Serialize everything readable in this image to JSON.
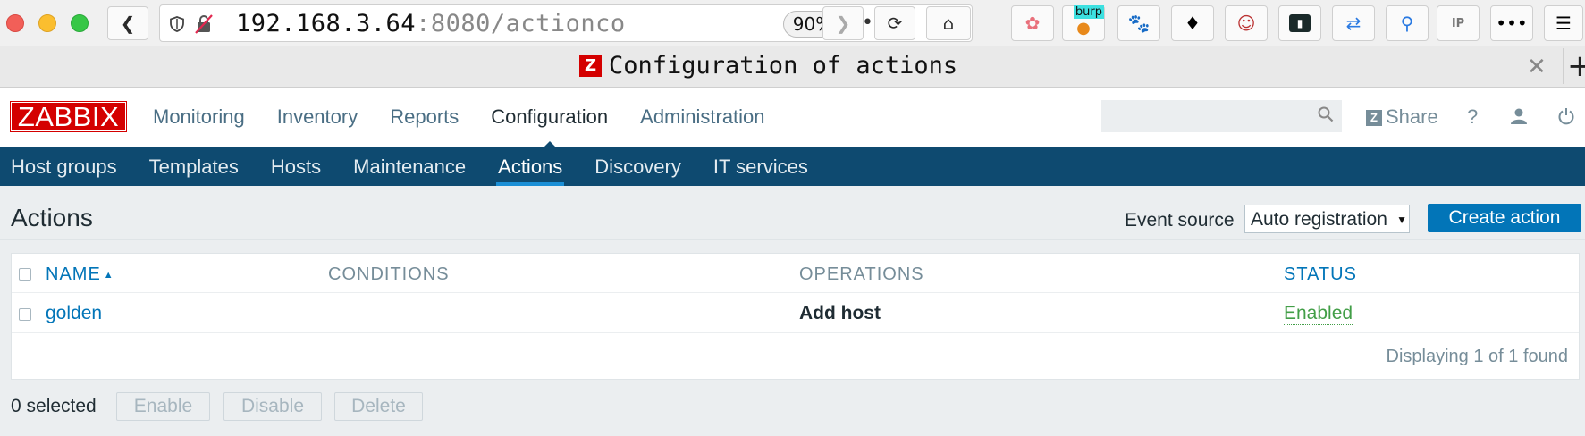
{
  "browser": {
    "url_host": "192.168.3.64",
    "url_rest": ":8080/actionco",
    "zoom": "90%",
    "tab_title": "Configuration of actions",
    "tab_favicon": "Z",
    "extensions": [
      "extension-icon-1",
      "burp-extension-icon",
      "gnome-extension-icon",
      "puzzle-extension-icon",
      "anime-extension-icon",
      "terminal-extension-icon",
      "repeat-extension-icon",
      "key-extension-icon",
      "ip-extension-icon",
      "more-extensions-icon",
      "menu-icon"
    ],
    "burp_badge": "burp"
  },
  "zabbix": {
    "logo": "ZABBIX",
    "topnav": [
      "Monitoring",
      "Inventory",
      "Reports",
      "Configuration",
      "Administration"
    ],
    "active_topnav": "Configuration",
    "share_label": "Share",
    "share_badge": "Z",
    "help_label": "?",
    "subnav": [
      "Host groups",
      "Templates",
      "Hosts",
      "Maintenance",
      "Actions",
      "Discovery",
      "IT services"
    ],
    "active_subnav": "Actions"
  },
  "page": {
    "title": "Actions",
    "event_source_label": "Event source",
    "event_source_value": "Auto registration",
    "create_button": "Create action"
  },
  "table": {
    "columns": [
      "NAME",
      "CONDITIONS",
      "OPERATIONS",
      "STATUS"
    ],
    "sort_arrow": "▲",
    "rows": [
      {
        "name": "golden",
        "conditions": "",
        "operations": "Add host",
        "status": "Enabled"
      }
    ],
    "paging": "Displaying 1 of 1 found"
  },
  "footer": {
    "selected": "0 selected",
    "buttons": [
      "Enable",
      "Disable",
      "Delete"
    ]
  }
}
